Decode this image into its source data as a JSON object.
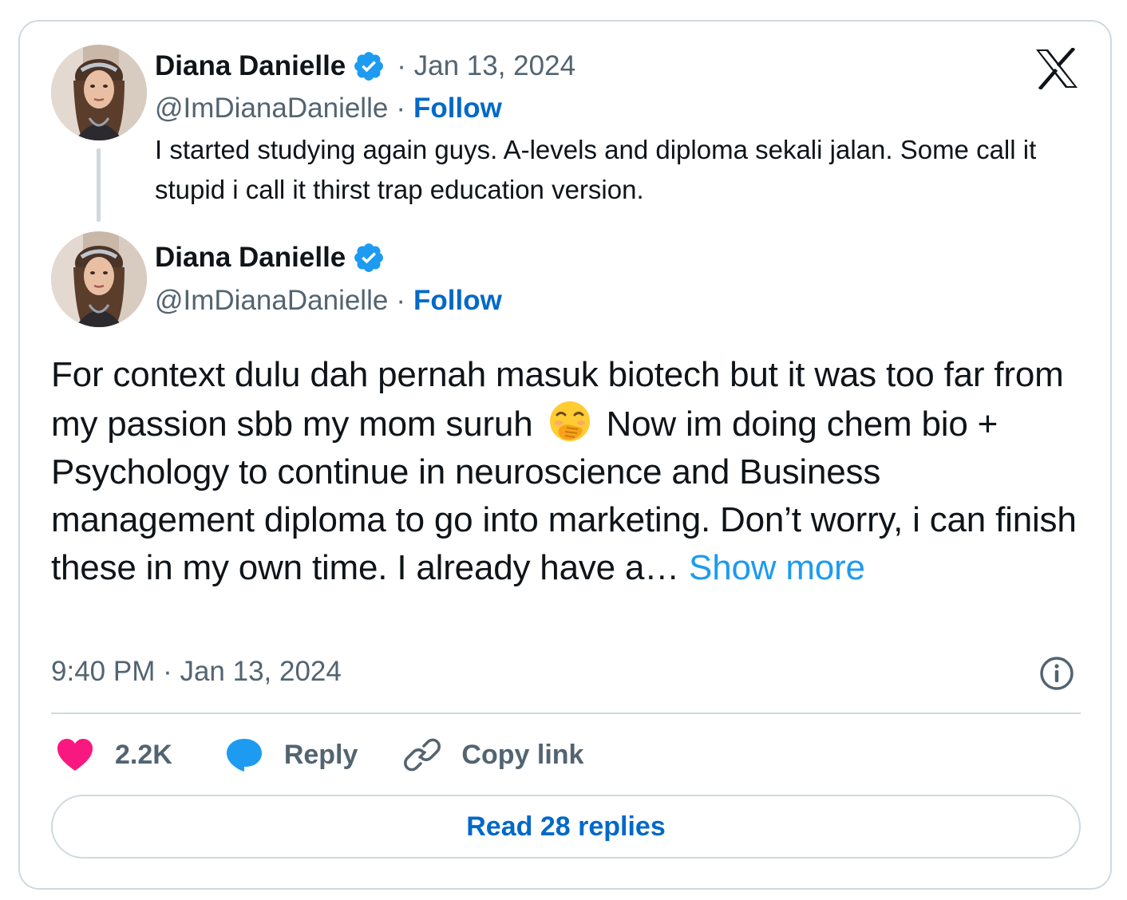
{
  "quoted_tweet": {
    "author_name": "Diana Danielle",
    "date_text": "· Jan 13, 2024",
    "handle": "@ImDianaDanielle",
    "separator": "·",
    "follow_label": "Follow",
    "text": "I started studying again guys. A-levels and diploma sekali jalan. Some call it stupid i call it thirst trap education version."
  },
  "main_tweet": {
    "author_name": "Diana Danielle",
    "handle": "@ImDianaDanielle",
    "separator": "·",
    "follow_label": "Follow",
    "text_before_emoji": "For context dulu dah pernah masuk biotech but it was too far from my passion sbb my mom suruh",
    "emoji_icon": "face-with-hand-over-mouth-icon",
    "text_after_emoji": "Now im doing chem bio + Psychology to continue in neuroscience and Business management diploma to go into marketing. Don’t worry, i can finish these in my own time. I already have a…",
    "show_more_label": "Show more",
    "timestamp": "9:40 PM · Jan 13, 2024"
  },
  "actions": {
    "like_count": "2.2K",
    "reply_label": "Reply",
    "copy_link_label": "Copy link"
  },
  "read_replies_label": "Read 28 replies",
  "colors": {
    "accent_blue": "#1d9bf0",
    "link_blue": "#0069c9",
    "heart_pink": "#f91880",
    "muted_text": "#536471",
    "border": "#cfd9de"
  }
}
